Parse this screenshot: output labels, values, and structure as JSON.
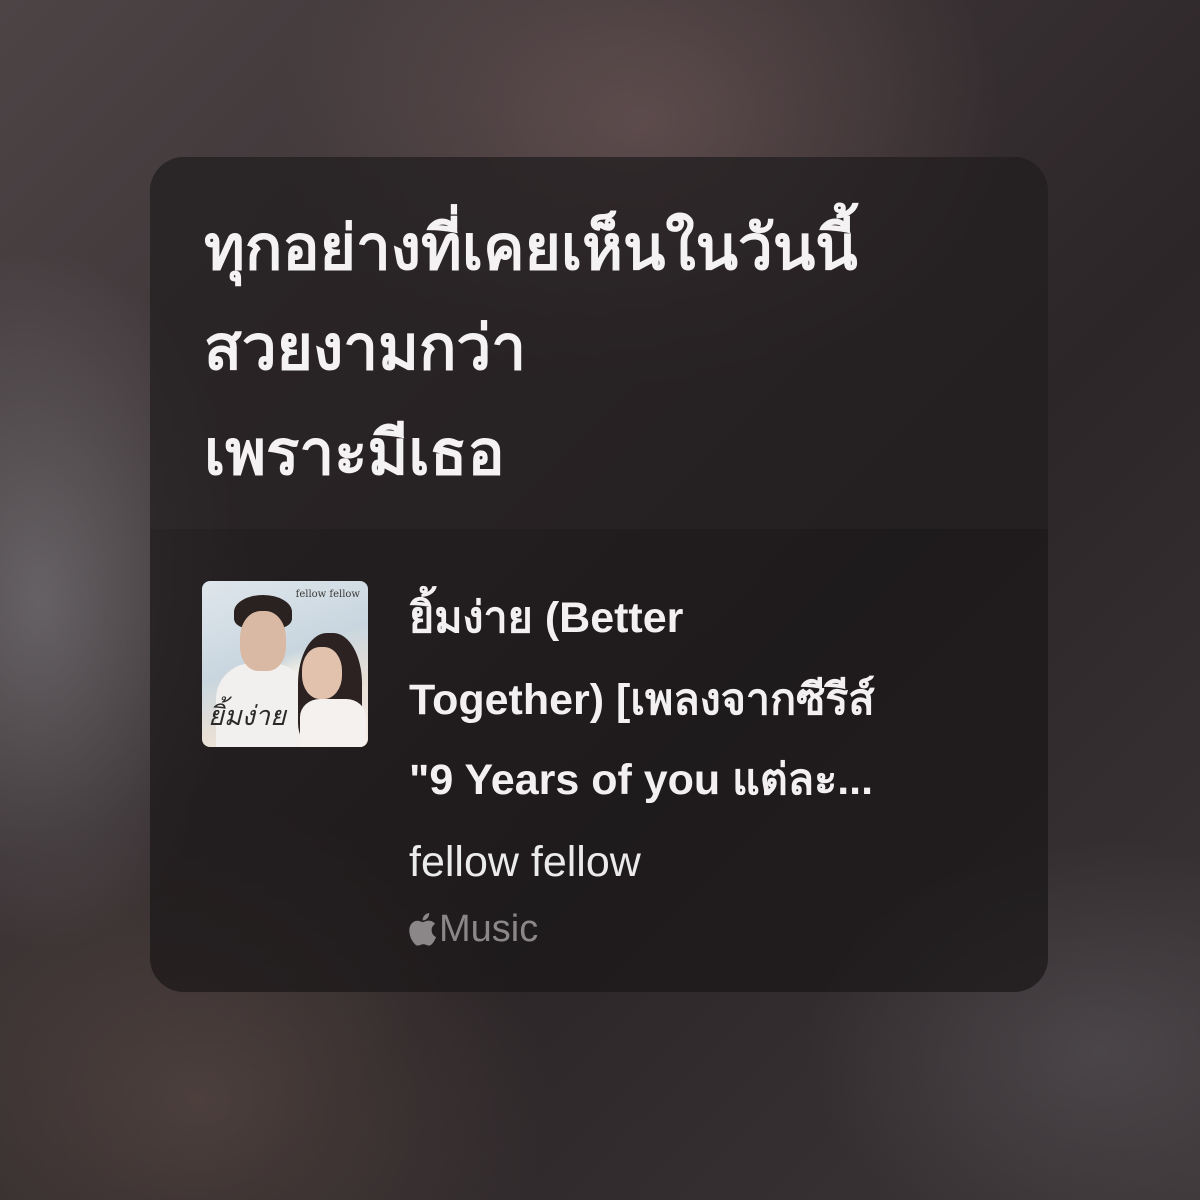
{
  "lyrics": {
    "lines": [
      "ทุกอย่างที่เคยเห็นในวันนี้",
      "สวยงามกว่า",
      "เพราะมีเธอ"
    ]
  },
  "song": {
    "title_lines": [
      "ยิ้มง่าย (Better",
      "Together) [เพลงจากซีรีส์",
      "\"9 Years of you แต่ละ..."
    ],
    "artist": "fellow fellow",
    "service_label": "Music",
    "service_icon": "apple-icon",
    "artwork": {
      "label": "fellow fellow",
      "title": "ยิ้มง่าย"
    }
  },
  "colors": {
    "lyric_text": "#f4f2f2",
    "service_gray": "#8b8788"
  }
}
